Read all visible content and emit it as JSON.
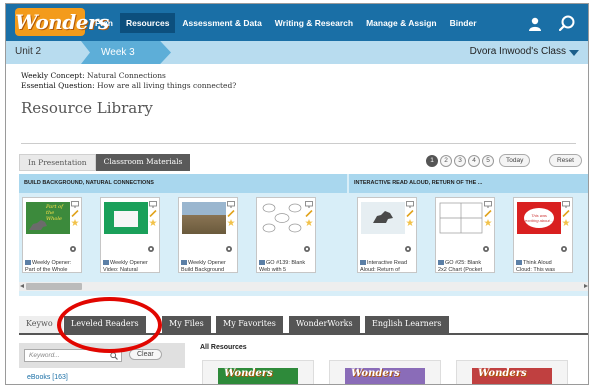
{
  "app": {
    "logo_text": "Wonders"
  },
  "nav": {
    "items": [
      {
        "label": "Plan",
        "active": false
      },
      {
        "label": "Resources",
        "active": true
      },
      {
        "label": "Assessment & Data",
        "active": false
      },
      {
        "label": "Writing & Research",
        "active": false
      },
      {
        "label": "Manage & Assign",
        "active": false
      },
      {
        "label": "Binder",
        "active": false
      }
    ],
    "icons": [
      "user-icon",
      "search-icon"
    ]
  },
  "subbar": {
    "unit": "Unit 2",
    "week": "Week 3",
    "class_name": "Dvora Inwood's Class"
  },
  "concept": {
    "weekly_label": "Weekly Concept:",
    "weekly_value": "Natural Connections",
    "question_label": "Essential Question:",
    "question_value": "How are all living things connected?"
  },
  "page_title": "Resource Library",
  "presentation_tabs": [
    "In Presentation",
    "Classroom Materials"
  ],
  "pager": {
    "pages": [
      "1",
      "2",
      "3",
      "4",
      "5"
    ],
    "active_page": "1",
    "today_label": "Today",
    "reset_label": "Reset"
  },
  "sections": [
    "BUILD BACKGROUND, NATURAL CONNECTIONS",
    "INTERACTIVE READ ALOUD, RETURN OF THE ..."
  ],
  "cards": [
    {
      "line1": "Weekly Opener:",
      "line2": "Part of the Whole",
      "thumb_text": "Part of the Whole",
      "thumb_color": "#3c8a3c"
    },
    {
      "line1": "Weekly Opener",
      "line2": "Video: Natural",
      "thumb_text": "",
      "thumb_color": "#1aa05a"
    },
    {
      "line1": "Weekly Opener",
      "line2": "Build Background",
      "thumb_text": "",
      "thumb_color": "#8a7454"
    },
    {
      "line1": "GO #139: Blank",
      "line2": "Web with 5",
      "thumb_text": "",
      "thumb_color": "#ffffff"
    },
    {
      "line1": "Interactive Read",
      "line2": "Aloud: Return of",
      "thumb_text": "",
      "thumb_color": "#dfe9ee"
    },
    {
      "line1": "GO #25: Blank",
      "line2": "2x2 Chart (Pocket",
      "thumb_text": "",
      "thumb_color": "#ffffff"
    },
    {
      "line1": "Think Aloud",
      "line2": "Cloud: This was",
      "thumb_text": "This was exciting about...",
      "thumb_color": "#d92020"
    }
  ],
  "bottom_tabs": [
    "Keywo",
    "Leveled Readers",
    "My Files",
    "My Favorites",
    "WonderWorks",
    "English Learners"
  ],
  "search": {
    "placeholder": "Keyword...",
    "clear_label": "Clear"
  },
  "filters": {
    "ebooks": "eBooks [163]"
  },
  "all_resources": "All Resources",
  "colors": {
    "nav_blue": "#1a6fa6",
    "accent_orange": "#f39b1b",
    "highlight_red": "#e10600",
    "subbar_blue": "#b8dcef"
  }
}
